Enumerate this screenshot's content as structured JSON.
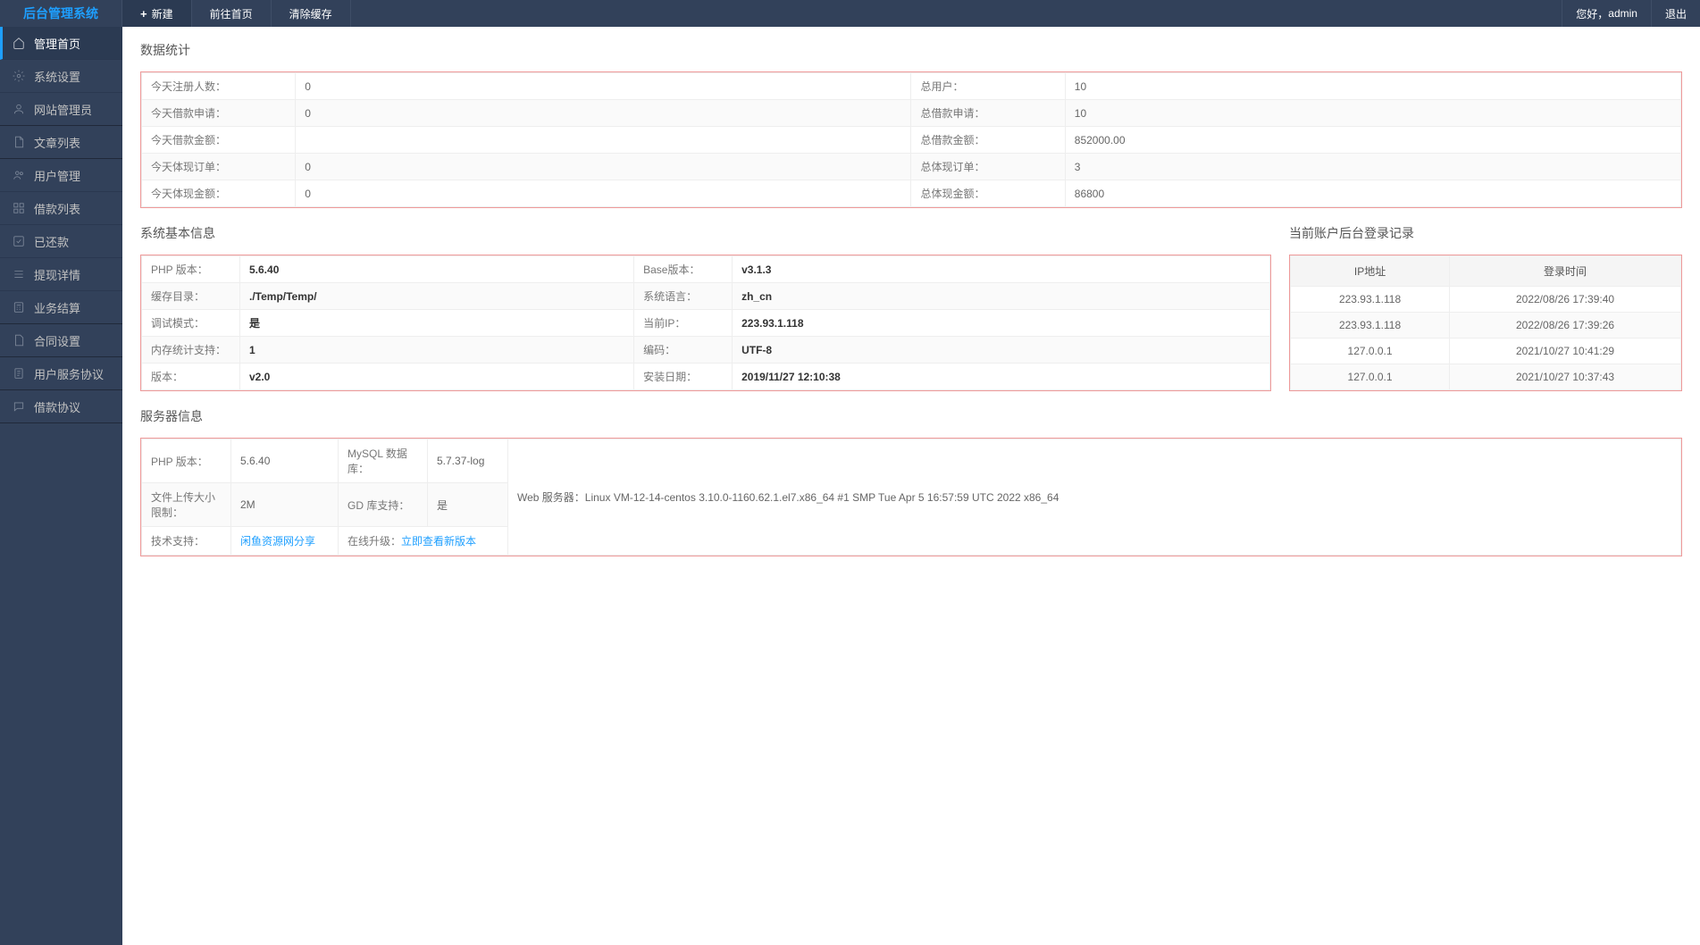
{
  "header": {
    "logo": "后台管理系统",
    "nav": {
      "new": "新建",
      "homepage": "前往首页",
      "clear_cache": "清除缓存"
    },
    "right": {
      "greeting": "您好，",
      "username": "admin",
      "logout": "退出"
    }
  },
  "sidebar": {
    "items": [
      {
        "label": "管理首页",
        "icon": "home",
        "active": true
      },
      {
        "label": "系统设置",
        "icon": "gear"
      },
      {
        "label": "网站管理员",
        "icon": "user"
      },
      {
        "label": "文章列表",
        "icon": "doc"
      },
      {
        "label": "用户管理",
        "icon": "users"
      },
      {
        "label": "借款列表",
        "icon": "grid"
      },
      {
        "label": "已还款",
        "icon": "check"
      },
      {
        "label": "提现详情",
        "icon": "list"
      },
      {
        "label": "业务结算",
        "icon": "calc"
      },
      {
        "label": "合同设置",
        "icon": "file"
      },
      {
        "label": "用户服务协议",
        "icon": "doc2"
      },
      {
        "label": "借款协议",
        "icon": "msg"
      }
    ]
  },
  "sections": {
    "stats_title": "数据统计",
    "stats": [
      {
        "l1": "今天注册人数：",
        "v1": "0",
        "l2": "总用户：",
        "v2": "10"
      },
      {
        "l1": "今天借款申请：",
        "v1": "0",
        "l2": "总借款申请：",
        "v2": "10"
      },
      {
        "l1": "今天借款金额：",
        "v1": "",
        "l2": "总借款金额：",
        "v2": "852000.00"
      },
      {
        "l1": "今天体现订单：",
        "v1": "0",
        "l2": "总体现订单：",
        "v2": "3"
      },
      {
        "l1": "今天体现金额：",
        "v1": "0",
        "l2": "总体现金额：",
        "v2": "86800"
      }
    ],
    "sysinfo_title": "系统基本信息",
    "sysinfo": [
      {
        "l1": "PHP 版本：",
        "v1": "5.6.40",
        "l2": "Base版本：",
        "v2": "v3.1.3"
      },
      {
        "l1": "缓存目录：",
        "v1": "./Temp/Temp/",
        "l2": "系统语言：",
        "v2": "zh_cn"
      },
      {
        "l1": "调试模式：",
        "v1": "是",
        "l2": "当前IP：",
        "v2": "223.93.1.118"
      },
      {
        "l1": "内存统计支持：",
        "v1": "1",
        "l2": "编码：",
        "v2": "UTF-8"
      },
      {
        "l1": "版本：",
        "v1": "v2.0",
        "l2": "安装日期：",
        "v2": "2019/11/27 12:10:38"
      }
    ],
    "login_title": "当前账户后台登录记录",
    "login_headers": {
      "ip": "IP地址",
      "time": "登录时间"
    },
    "logins": [
      {
        "ip": "223.93.1.118",
        "time": "2022/08/26 17:39:40"
      },
      {
        "ip": "223.93.1.118",
        "time": "2022/08/26 17:39:26"
      },
      {
        "ip": "127.0.0.1",
        "time": "2021/10/27 10:41:29"
      },
      {
        "ip": "127.0.0.1",
        "time": "2021/10/27 10:37:43"
      }
    ],
    "server_title": "服务器信息",
    "server": {
      "php_l": "PHP 版本：",
      "php_v": "5.6.40",
      "mysql_l": "MySQL 数据库：",
      "mysql_v": "5.7.37-log",
      "upload_l": "文件上传大小限制：",
      "upload_v": "2M",
      "gd_l": "GD 库支持：",
      "gd_v": "是",
      "web_l": "Web 服务器：",
      "web_v": "Linux VM-12-14-centos 3.10.0-1160.62.1.el7.x86_64 #1 SMP Tue Apr 5 16:57:59 UTC 2022 x86_64",
      "tech_l": "技术支持：",
      "tech_v": "闲鱼资源网分享",
      "upgrade_l": "在线升级：",
      "upgrade_v": "立即查看新版本"
    }
  }
}
